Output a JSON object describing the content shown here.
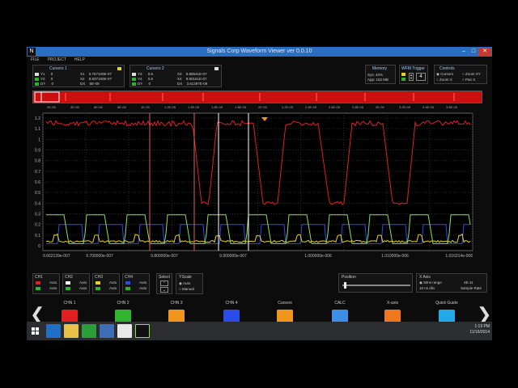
{
  "window": {
    "title": "Signals Corp Waveform Viewer ver 0.0.10",
    "app_icon": "N",
    "min": "–",
    "max": "□",
    "close": "✕"
  },
  "menu": [
    "FILE",
    "PROJECT",
    "HELP"
  ],
  "cursors1": {
    "title": "Cursors 1",
    "rows": [
      {
        "l": "Y1",
        "v": "0",
        "k": "X1",
        "kv": "9.767100E-07"
      },
      {
        "l": "Y2",
        "v": "0",
        "k": "X2",
        "kv": "9.837100E-07"
      },
      {
        "l": "DY",
        "v": "0",
        "k": "DX",
        "kv": "5E-09"
      }
    ]
  },
  "cursors2": {
    "title": "Cursors 2",
    "rows": [
      {
        "l": "Y3",
        "v": "0.6",
        "k": "X3",
        "kv": "9.86541E-07"
      },
      {
        "l": "Y4",
        "v": "0.6",
        "k": "X4",
        "kv": "9.90161E-07"
      },
      {
        "l": "DY",
        "v": "0",
        "k": "DX",
        "kv": "3.61397E-09"
      }
    ]
  },
  "memory": {
    "title": "Memory",
    "sys": "Sys: 42%",
    "app": "App: 162 MB"
  },
  "wfm_trigger": {
    "title": "WFM Trigger",
    "value": "4"
  },
  "controls": {
    "title": "Controls",
    "opts": [
      "Cursors",
      "Zoom XY",
      "Zoom X",
      "Pan X"
    ]
  },
  "overview_ticks": [
    "2E-06",
    "4E-06",
    "6E-06",
    "8E-06",
    "1E-05",
    "1.2E-05",
    "1.4E-05",
    "1.6E-05",
    "1.8E-05",
    "2E-05",
    "2.2E-05",
    "2.4E-05",
    "2.6E-05",
    "2.8E-05",
    "3E-05",
    "3.2E-05",
    "3.4E-05",
    "3.6E-05"
  ],
  "plot": {
    "y_ticks": [
      "1.2",
      "1.1",
      "1",
      "0.9",
      "0.8",
      "0.7",
      "0.6",
      "0.5",
      "0.4",
      "0.3",
      "0.2",
      "0.1",
      "0"
    ],
    "x_labels": [
      "9.662139e-007",
      "9.700000e-007",
      "9.800000e-007",
      "9.900000e-007",
      "1.000000e-006",
      "1.010000e-006",
      "1.016214e-006"
    ]
  },
  "channels": [
    {
      "name": "CH1",
      "color": "#e02020",
      "a": "Auto",
      "b": "Auto"
    },
    {
      "name": "CH2",
      "color": "#ffffff",
      "a": "Auto",
      "b": "Auto"
    },
    {
      "name": "CH3",
      "color": "#e8d21c",
      "a": "Auto",
      "b": "Auto"
    },
    {
      "name": "CH4",
      "color": "#2a4de8",
      "a": "Auto",
      "b": "Auto"
    }
  ],
  "select": {
    "title": "Select"
  },
  "yscale": {
    "title": "YScale",
    "opts": [
      "Auto",
      "Manual"
    ]
  },
  "position": {
    "title": "Position"
  },
  "xaxis": {
    "title": "X Axis",
    "range": "50ns range",
    "div": "10 ns /div",
    "rate_val": "4E-11",
    "rate_lbl": "Sample Rate"
  },
  "tools": [
    "CHN 1",
    "CHN 2",
    "CHN 3",
    "CHN 4",
    "Cursors",
    "CALC",
    "X-axis",
    "Quick Guide"
  ],
  "tool_colors": [
    "#e02020",
    "#2fb52f",
    "#f0961c",
    "#2a4de8",
    "#f0961c",
    "#3c8ee8",
    "#f0781c",
    "#23a9e8"
  ],
  "tray": {
    "time": "1:19 PM",
    "date": "11/16/2014"
  }
}
